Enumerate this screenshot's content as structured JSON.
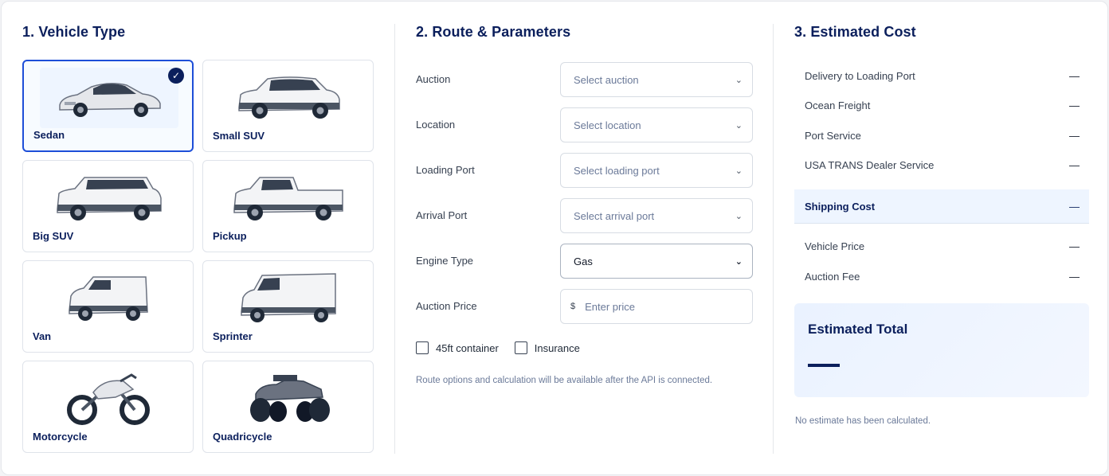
{
  "vehicle": {
    "title": "1. Vehicle Type",
    "items": [
      {
        "label": "Sedan",
        "icon": "sedan-icon",
        "selected": true
      },
      {
        "label": "Small SUV",
        "icon": "small-suv-icon"
      },
      {
        "label": "Big SUV",
        "icon": "big-suv-icon"
      },
      {
        "label": "Pickup",
        "icon": "pickup-icon"
      },
      {
        "label": "Van",
        "icon": "van-icon"
      },
      {
        "label": "Sprinter",
        "icon": "sprinter-icon"
      },
      {
        "label": "Motorcycle",
        "icon": "motorcycle-icon"
      },
      {
        "label": "Quadricycle",
        "icon": "quadricycle-icon"
      }
    ],
    "check_icon": "checkmark-icon"
  },
  "route": {
    "title": "2. Route & Parameters",
    "fields": [
      {
        "label": "Auction",
        "placeholder": "Select auction"
      },
      {
        "label": "Location",
        "placeholder": "Select location"
      },
      {
        "label": "Loading Port",
        "placeholder": "Select loading port"
      },
      {
        "label": "Arrival Port",
        "placeholder": "Select arrival port"
      },
      {
        "label": "Engine Type",
        "value": "Gas"
      },
      {
        "label": "Auction Price",
        "prefix": "$",
        "placeholder": "Enter price"
      }
    ],
    "checkboxes": [
      {
        "label": "45ft container",
        "checked": false
      },
      {
        "label": "Insurance",
        "checked": false
      }
    ],
    "note": "Route options and calculation will be available after the API is connected."
  },
  "cost": {
    "title": "3. Estimated Cost",
    "rows": [
      {
        "label": "Delivery to Loading Port",
        "value": "—"
      },
      {
        "label": "Ocean Freight",
        "value": "—"
      },
      {
        "label": "Port Service",
        "value": "—"
      },
      {
        "label": "USA TRANS Dealer Service",
        "value": "—"
      }
    ],
    "shipping": {
      "label": "Shipping Cost",
      "value": "—"
    },
    "extra_rows": [
      {
        "label": "Vehicle Price",
        "value": "—"
      },
      {
        "label": "Auction Fee",
        "value": "—"
      }
    ],
    "total": {
      "label": "Estimated Total",
      "value": "—"
    },
    "status": "No estimate has been calculated."
  },
  "colors": {
    "accent": "#0b1f5c",
    "selected_border": "#1d4ed8",
    "highlight_bg": "#eef5ff"
  }
}
